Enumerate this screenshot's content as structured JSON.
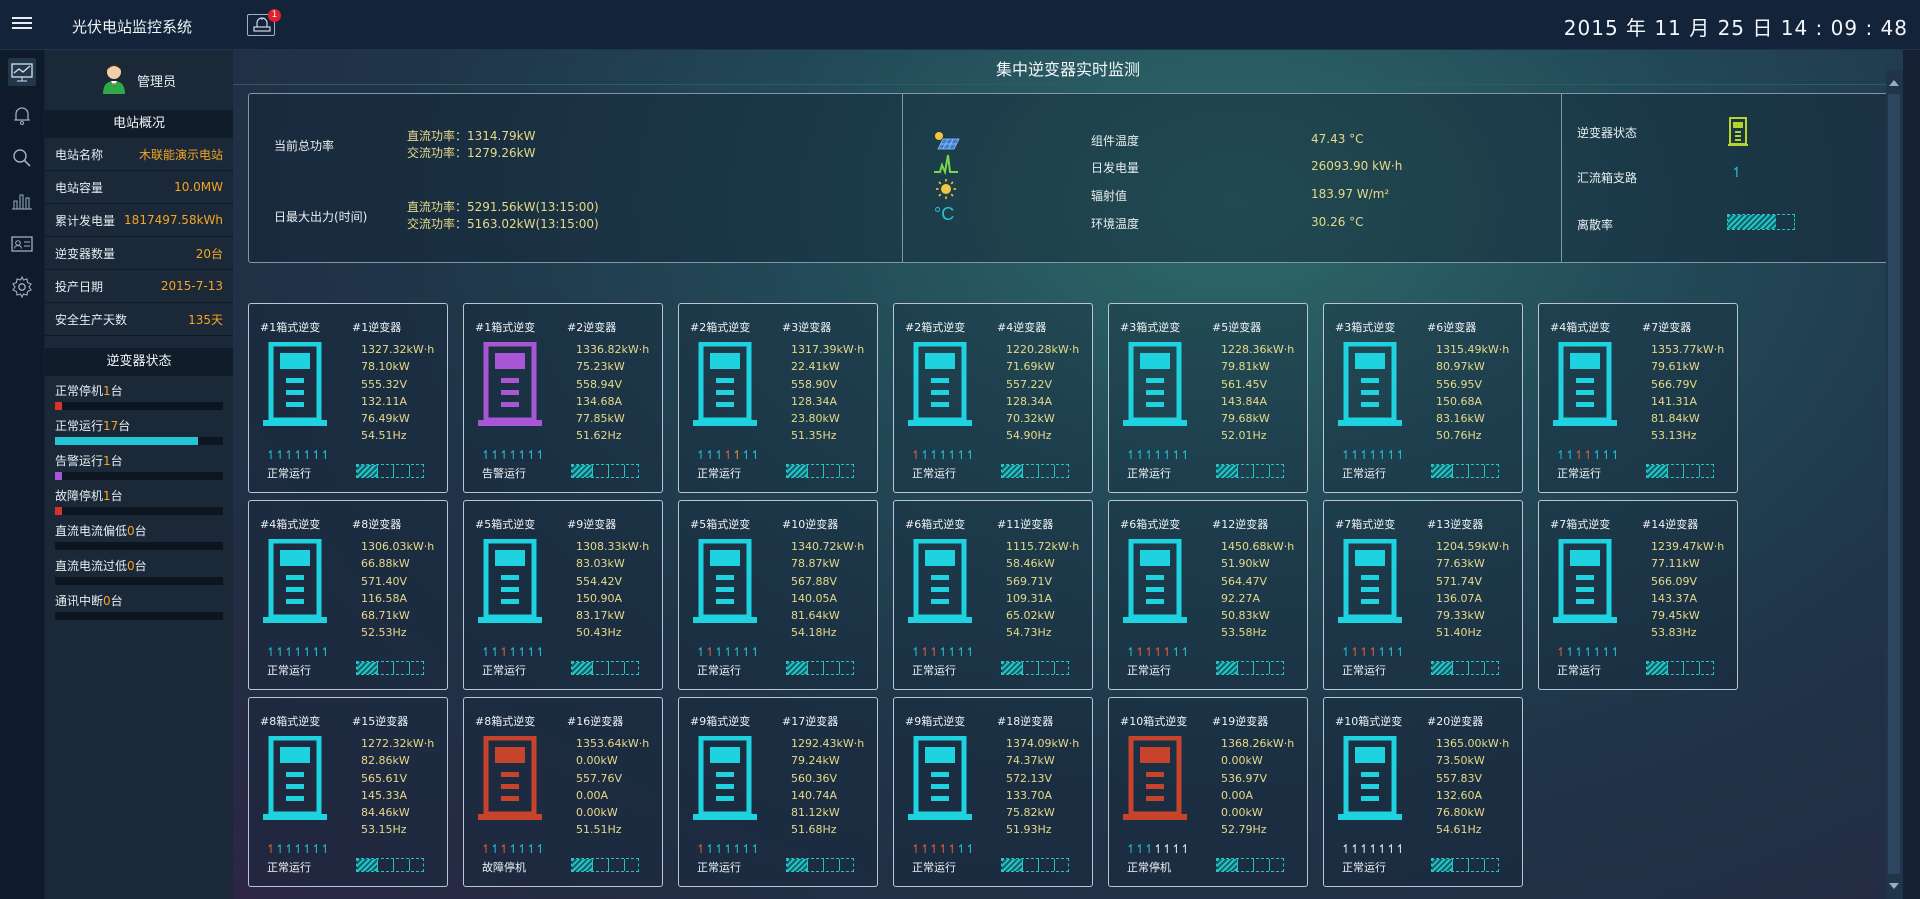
{
  "app": {
    "title": "光伏电站监控系统",
    "alarm_count": "1",
    "clock": "2015 年 11 月 25 日  14 : 09 : 48"
  },
  "user": {
    "name": "管理员"
  },
  "overview": {
    "title": "电站概况",
    "rows": [
      {
        "label": "电站名称",
        "value": "木联能演示电站"
      },
      {
        "label": "电站容量",
        "value": "10.0MW"
      },
      {
        "label": "累计发电量",
        "value": "1817497.58kWh"
      },
      {
        "label": "逆变器数量",
        "value": "20台"
      },
      {
        "label": "投产日期",
        "value": "2015-7-13"
      },
      {
        "label": "安全生产天数",
        "value": "135天"
      }
    ]
  },
  "inverter_status": {
    "title": "逆变器状态",
    "items": [
      {
        "label": "正常停机",
        "count": "1",
        "unit": "台",
        "fraction": 0.05,
        "color": "#d8322a"
      },
      {
        "label": "正常运行",
        "count": "17",
        "unit": "台",
        "fraction": 0.85,
        "color": "#23c4d4"
      },
      {
        "label": "告警运行",
        "count": "1",
        "unit": "台",
        "fraction": 0.05,
        "color": "#a855d6"
      },
      {
        "label": "故障停机",
        "count": "1",
        "unit": "台",
        "fraction": 0.05,
        "color": "#d8322a"
      },
      {
        "label": "直流电流偏低",
        "count": "0",
        "unit": "台",
        "fraction": 0,
        "color": "#23c4d4"
      },
      {
        "label": "直流电流过低",
        "count": "0",
        "unit": "台",
        "fraction": 0,
        "color": "#23c4d4"
      },
      {
        "label": "通讯中断",
        "count": "0",
        "unit": "台",
        "fraction": 0,
        "color": "#23c4d4"
      }
    ]
  },
  "main": {
    "title": "集中逆变器实时监测",
    "summary": {
      "total_power_label": "当前总功率",
      "dc_power": "直流功率：1314.79kW",
      "ac_power": "交流功率：1279.26kW",
      "max_output_label": "日最大出力(时间)",
      "dc_max": "直流功率：5291.56kW(13:15:00)",
      "ac_max": "交流功率：5163.02kW(13:15:00)",
      "env": [
        {
          "icon": "solar-panel-icon",
          "label": "组件温度",
          "value": "47.43 °C"
        },
        {
          "icon": "power-lightning-icon",
          "label": "日发电量",
          "value": "26093.90 kW·h"
        },
        {
          "icon": "sun-icon",
          "label": "辐射值",
          "value": "183.97 W/m²"
        },
        {
          "icon": "celsius-icon",
          "label": "环境温度",
          "value": "30.26 °C"
        }
      ],
      "status_label": "逆变器状态",
      "branch_label": "汇流箱支路",
      "dispersion_label": "离散率"
    },
    "inverters": [
      {
        "box": "#1箱式逆变",
        "name": "#1逆变器",
        "energy": "1327.32kW·h",
        "dc_power": "78.10kW",
        "voltage": "555.32V",
        "current": "132.11A",
        "ac_power": "76.49kW",
        "freq": "54.51Hz",
        "state": "正常运行",
        "color": "#1ed2df",
        "arrows": [
          "c",
          "c",
          "c",
          "c",
          "c",
          "c",
          "c"
        ]
      },
      {
        "box": "#1箱式逆变",
        "name": "#2逆变器",
        "energy": "1336.82kW·h",
        "dc_power": "75.23kW",
        "voltage": "558.94V",
        "current": "134.68A",
        "ac_power": "77.85kW",
        "freq": "51.62Hz",
        "state": "告警运行",
        "color": "#a855d6",
        "arrows": [
          "c",
          "c",
          "c",
          "c",
          "c",
          "c",
          "c"
        ]
      },
      {
        "box": "#2箱式逆变",
        "name": "#3逆变器",
        "energy": "1317.39kW·h",
        "dc_power": "22.41kW",
        "voltage": "558.90V",
        "current": "128.34A",
        "ac_power": "23.80kW",
        "freq": "51.35Hz",
        "state": "正常运行",
        "color": "#1ed2df",
        "arrows": [
          "c",
          "c",
          "c",
          "r",
          "o",
          "c",
          "c"
        ]
      },
      {
        "box": "#2箱式逆变",
        "name": "#4逆变器",
        "energy": "1220.28kW·h",
        "dc_power": "71.69kW",
        "voltage": "557.22V",
        "current": "128.34A",
        "ac_power": "70.32kW",
        "freq": "54.90Hz",
        "state": "正常运行",
        "color": "#1ed2df",
        "arrows": [
          "r",
          "c",
          "c",
          "c",
          "c",
          "c",
          "c"
        ]
      },
      {
        "box": "#3箱式逆变",
        "name": "#5逆变器",
        "energy": "1228.36kW·h",
        "dc_power": "79.81kW",
        "voltage": "561.45V",
        "current": "143.84A",
        "ac_power": "79.68kW",
        "freq": "52.01Hz",
        "state": "正常运行",
        "color": "#1ed2df",
        "arrows": [
          "c",
          "c",
          "c",
          "c",
          "c",
          "c",
          "c"
        ]
      },
      {
        "box": "#3箱式逆变",
        "name": "#6逆变器",
        "energy": "1315.49kW·h",
        "dc_power": "80.97kW",
        "voltage": "556.95V",
        "current": "150.68A",
        "ac_power": "83.16kW",
        "freq": "50.76Hz",
        "state": "正常运行",
        "color": "#1ed2df",
        "arrows": [
          "c",
          "c",
          "c",
          "c",
          "c",
          "c",
          "c"
        ]
      },
      {
        "box": "#4箱式逆变",
        "name": "#7逆变器",
        "energy": "1353.77kW·h",
        "dc_power": "79.61kW",
        "voltage": "566.79V",
        "current": "141.31A",
        "ac_power": "81.84kW",
        "freq": "53.13Hz",
        "state": "正常运行",
        "color": "#1ed2df",
        "arrows": [
          "c",
          "c",
          "r",
          "r",
          "c",
          "c",
          "c"
        ]
      },
      {
        "box": "#4箱式逆变",
        "name": "#8逆变器",
        "energy": "1306.03kW·h",
        "dc_power": "66.88kW",
        "voltage": "571.40V",
        "current": "116.58A",
        "ac_power": "68.71kW",
        "freq": "52.53Hz",
        "state": "正常运行",
        "color": "#1ed2df",
        "arrows": [
          "c",
          "c",
          "c",
          "c",
          "c",
          "c",
          "c"
        ]
      },
      {
        "box": "#5箱式逆变",
        "name": "#9逆变器",
        "energy": "1308.33kW·h",
        "dc_power": "83.03kW",
        "voltage": "554.42V",
        "current": "150.90A",
        "ac_power": "83.17kW",
        "freq": "50.43Hz",
        "state": "正常运行",
        "color": "#1ed2df",
        "arrows": [
          "c",
          "c",
          "r",
          "c",
          "c",
          "c",
          "c"
        ]
      },
      {
        "box": "#5箱式逆变",
        "name": "#10逆变器",
        "energy": "1340.72kW·h",
        "dc_power": "78.87kW",
        "voltage": "567.88V",
        "current": "140.05A",
        "ac_power": "81.64kW",
        "freq": "54.18Hz",
        "state": "正常运行",
        "color": "#1ed2df",
        "arrows": [
          "c",
          "r",
          "c",
          "c",
          "c",
          "c",
          "c"
        ]
      },
      {
        "box": "#6箱式逆变",
        "name": "#11逆变器",
        "energy": "1115.72kW·h",
        "dc_power": "58.46kW",
        "voltage": "569.71V",
        "current": "109.31A",
        "ac_power": "65.02kW",
        "freq": "54.73Hz",
        "state": "正常运行",
        "color": "#1ed2df",
        "arrows": [
          "c",
          "r",
          "r",
          "c",
          "c",
          "c",
          "c"
        ]
      },
      {
        "box": "#6箱式逆变",
        "name": "#12逆变器",
        "energy": "1450.68kW·h",
        "dc_power": "51.90kW",
        "voltage": "564.47V",
        "current": "92.27A",
        "ac_power": "50.83kW",
        "freq": "53.58Hz",
        "state": "正常运行",
        "color": "#1ed2df",
        "arrows": [
          "c",
          "r",
          "r",
          "r",
          "r",
          "c",
          "c"
        ]
      },
      {
        "box": "#7箱式逆变",
        "name": "#13逆变器",
        "energy": "1204.59kW·h",
        "dc_power": "77.63kW",
        "voltage": "571.74V",
        "current": "136.07A",
        "ac_power": "79.33kW",
        "freq": "51.40Hz",
        "state": "正常运行",
        "color": "#1ed2df",
        "arrows": [
          "c",
          "r",
          "r",
          "r",
          "c",
          "c",
          "c"
        ]
      },
      {
        "box": "#7箱式逆变",
        "name": "#14逆变器",
        "energy": "1239.47kW·h",
        "dc_power": "77.11kW",
        "voltage": "566.09V",
        "current": "143.37A",
        "ac_power": "79.45kW",
        "freq": "53.83Hz",
        "state": "正常运行",
        "color": "#1ed2df",
        "arrows": [
          "r",
          "c",
          "c",
          "c",
          "c",
          "c",
          "c"
        ]
      },
      {
        "box": "#8箱式逆变",
        "name": "#15逆变器",
        "energy": "1272.32kW·h",
        "dc_power": "82.86kW",
        "voltage": "565.61V",
        "current": "145.33A",
        "ac_power": "84.46kW",
        "freq": "53.15Hz",
        "state": "正常运行",
        "color": "#1ed2df",
        "arrows": [
          "r",
          "c",
          "c",
          "c",
          "c",
          "c",
          "c"
        ]
      },
      {
        "box": "#8箱式逆变",
        "name": "#16逆变器",
        "energy": "1353.64kW·h",
        "dc_power": "0.00kW",
        "voltage": "557.76V",
        "current": "0.00A",
        "ac_power": "0.00kW",
        "freq": "51.51Hz",
        "state": "故障停机",
        "color": "#c8432c",
        "arrows": [
          "r",
          "c",
          "r",
          "c",
          "c",
          "c",
          "c"
        ]
      },
      {
        "box": "#9箱式逆变",
        "name": "#17逆变器",
        "energy": "1292.43kW·h",
        "dc_power": "79.24kW",
        "voltage": "560.36V",
        "current": "140.74A",
        "ac_power": "81.12kW",
        "freq": "51.68Hz",
        "state": "正常运行",
        "color": "#1ed2df",
        "arrows": [
          "r",
          "c",
          "c",
          "c",
          "c",
          "c",
          "c"
        ]
      },
      {
        "box": "#9箱式逆变",
        "name": "#18逆变器",
        "energy": "1374.09kW·h",
        "dc_power": "74.37kW",
        "voltage": "572.13V",
        "current": "133.70A",
        "ac_power": "75.82kW",
        "freq": "51.93Hz",
        "state": "正常运行",
        "color": "#1ed2df",
        "arrows": [
          "r",
          "r",
          "r",
          "r",
          "r",
          "c",
          "c"
        ]
      },
      {
        "box": "#10箱式逆变",
        "name": "#19逆变器",
        "energy": "1368.26kW·h",
        "dc_power": "0.00kW",
        "voltage": "536.97V",
        "current": "0.00A",
        "ac_power": "0.00kW",
        "freq": "52.79Hz",
        "state": "正常停机",
        "color": "#c8432c",
        "arrows": [
          "c",
          "c",
          "c",
          "w",
          "w",
          "w",
          "w"
        ]
      },
      {
        "box": "#10箱式逆变",
        "name": "#20逆变器",
        "energy": "1365.00kW·h",
        "dc_power": "73.50kW",
        "voltage": "557.83V",
        "current": "132.60A",
        "ac_power": "76.80kW",
        "freq": "54.61Hz",
        "state": "正常运行",
        "color": "#1ed2df",
        "arrows": [
          "w",
          "w",
          "w",
          "w",
          "w",
          "w",
          "w"
        ]
      }
    ]
  }
}
